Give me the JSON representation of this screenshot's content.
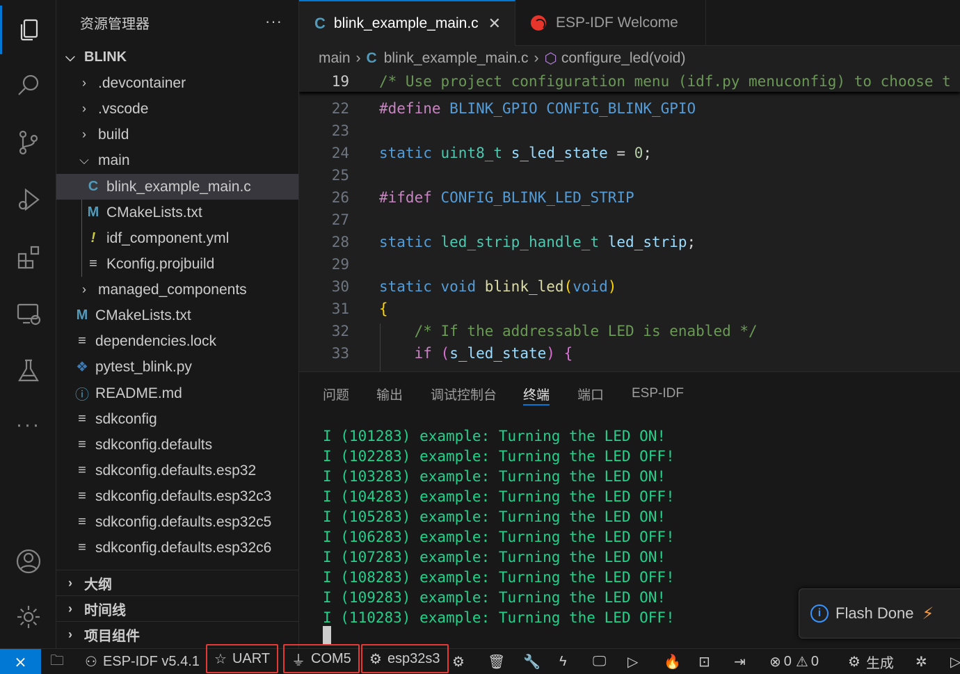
{
  "sidebar": {
    "title": "资源管理器",
    "more": "···",
    "root": "BLINK",
    "items": [
      {
        "label": ".devcontainer",
        "kind": "folder",
        "open": false
      },
      {
        "label": ".vscode",
        "kind": "folder",
        "open": false
      },
      {
        "label": "build",
        "kind": "folder",
        "open": false
      },
      {
        "label": "main",
        "kind": "folder",
        "open": true
      },
      {
        "label": "blink_example_main.c",
        "kind": "c-file"
      },
      {
        "label": "CMakeLists.txt",
        "kind": "cmake-file"
      },
      {
        "label": "idf_component.yml",
        "kind": "yaml-file"
      },
      {
        "label": "Kconfig.projbuild",
        "kind": "text-file"
      },
      {
        "label": "managed_components",
        "kind": "folder",
        "open": false
      },
      {
        "label": "CMakeLists.txt",
        "kind": "cmake-file"
      },
      {
        "label": "dependencies.lock",
        "kind": "text-file"
      },
      {
        "label": "pytest_blink.py",
        "kind": "python-file"
      },
      {
        "label": "README.md",
        "kind": "info-file"
      },
      {
        "label": "sdkconfig",
        "kind": "text-file"
      },
      {
        "label": "sdkconfig.defaults",
        "kind": "text-file"
      },
      {
        "label": "sdkconfig.defaults.esp32",
        "kind": "text-file"
      },
      {
        "label": "sdkconfig.defaults.esp32c3",
        "kind": "text-file"
      },
      {
        "label": "sdkconfig.defaults.esp32c5",
        "kind": "text-file"
      },
      {
        "label": "sdkconfig.defaults.esp32c6",
        "kind": "text-file"
      }
    ],
    "sections": [
      "大纲",
      "时间线",
      "项目组件"
    ]
  },
  "tabs": [
    {
      "label": "blink_example_main.c",
      "active": true
    },
    {
      "label": "ESP-IDF Welcome",
      "active": false
    }
  ],
  "breadcrumb": {
    "folder": "main",
    "file": "blink_example_main.c",
    "symbol": "configure_led(void)"
  },
  "code": {
    "sticky_line": {
      "num": "19",
      "text": "/* Use project configuration menu (idf.py menuconfig) to choose t"
    },
    "line_numbers": [
      "22",
      "23",
      "24",
      "25",
      "26",
      "27",
      "28",
      "29",
      "30",
      "31",
      "32",
      "33"
    ]
  },
  "panel": {
    "tabs": [
      "问题",
      "输出",
      "调试控制台",
      "终端",
      "端口",
      "ESP-IDF"
    ],
    "active_tab": "终端",
    "terminal_lines": [
      "I (101283) example: Turning the LED ON!",
      "I (102283) example: Turning the LED OFF!",
      "I (103283) example: Turning the LED ON!",
      "I (104283) example: Turning the LED OFF!",
      "I (105283) example: Turning the LED ON!",
      "I (106283) example: Turning the LED OFF!",
      "I (107283) example: Turning the LED ON!",
      "I (108283) example: Turning the LED OFF!",
      "I (109283) example: Turning the LED ON!",
      "I (110283) example: Turning the LED OFF!"
    ]
  },
  "toast": {
    "message": "Flash Done"
  },
  "status": {
    "idf_version": "ESP-IDF v5.4.1",
    "flash_method": "UART",
    "port": "COM5",
    "target": "esp32s3",
    "errors": "0",
    "warnings": "0",
    "build": "生成"
  },
  "colors": {
    "accent": "#0078d4",
    "terminal_text": "#23d18b",
    "highlight_box": "#e53935"
  }
}
